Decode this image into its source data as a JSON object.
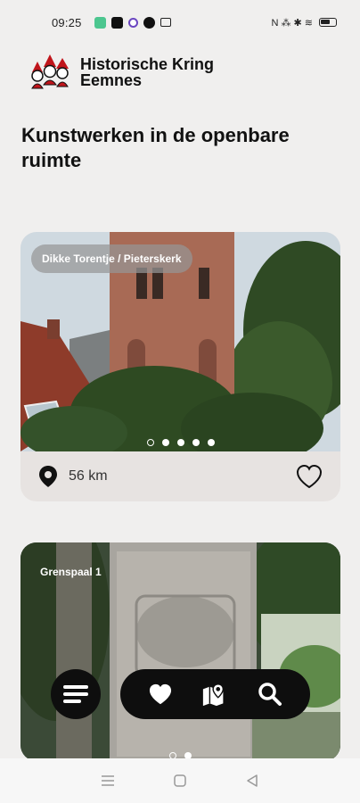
{
  "status_bar": {
    "time": "09:25",
    "right_text": "N ⁂ ✱ ≋"
  },
  "header": {
    "org_name_line1": "Historische Kring",
    "org_name_line2": "Eemnes"
  },
  "page": {
    "title": "Kunstwerken in de openbare ruimte"
  },
  "cards": [
    {
      "label": "Dikke Torentje / Pieterskerk",
      "distance": "56 km",
      "dots": 5,
      "active_dot": 0
    },
    {
      "label": "Grenspaal 1",
      "dots": 2,
      "active_dot": 0
    }
  ],
  "nav": {
    "menu_icon": "menu-icon",
    "favorites_icon": "heart-icon",
    "map_icon": "map-pin-icon",
    "search_icon": "search-icon"
  },
  "colors": {
    "background": "#f0efee",
    "card_footer": "#e7e3e1",
    "nav_background": "#0e0e0e",
    "brand_red": "#c0151b"
  }
}
